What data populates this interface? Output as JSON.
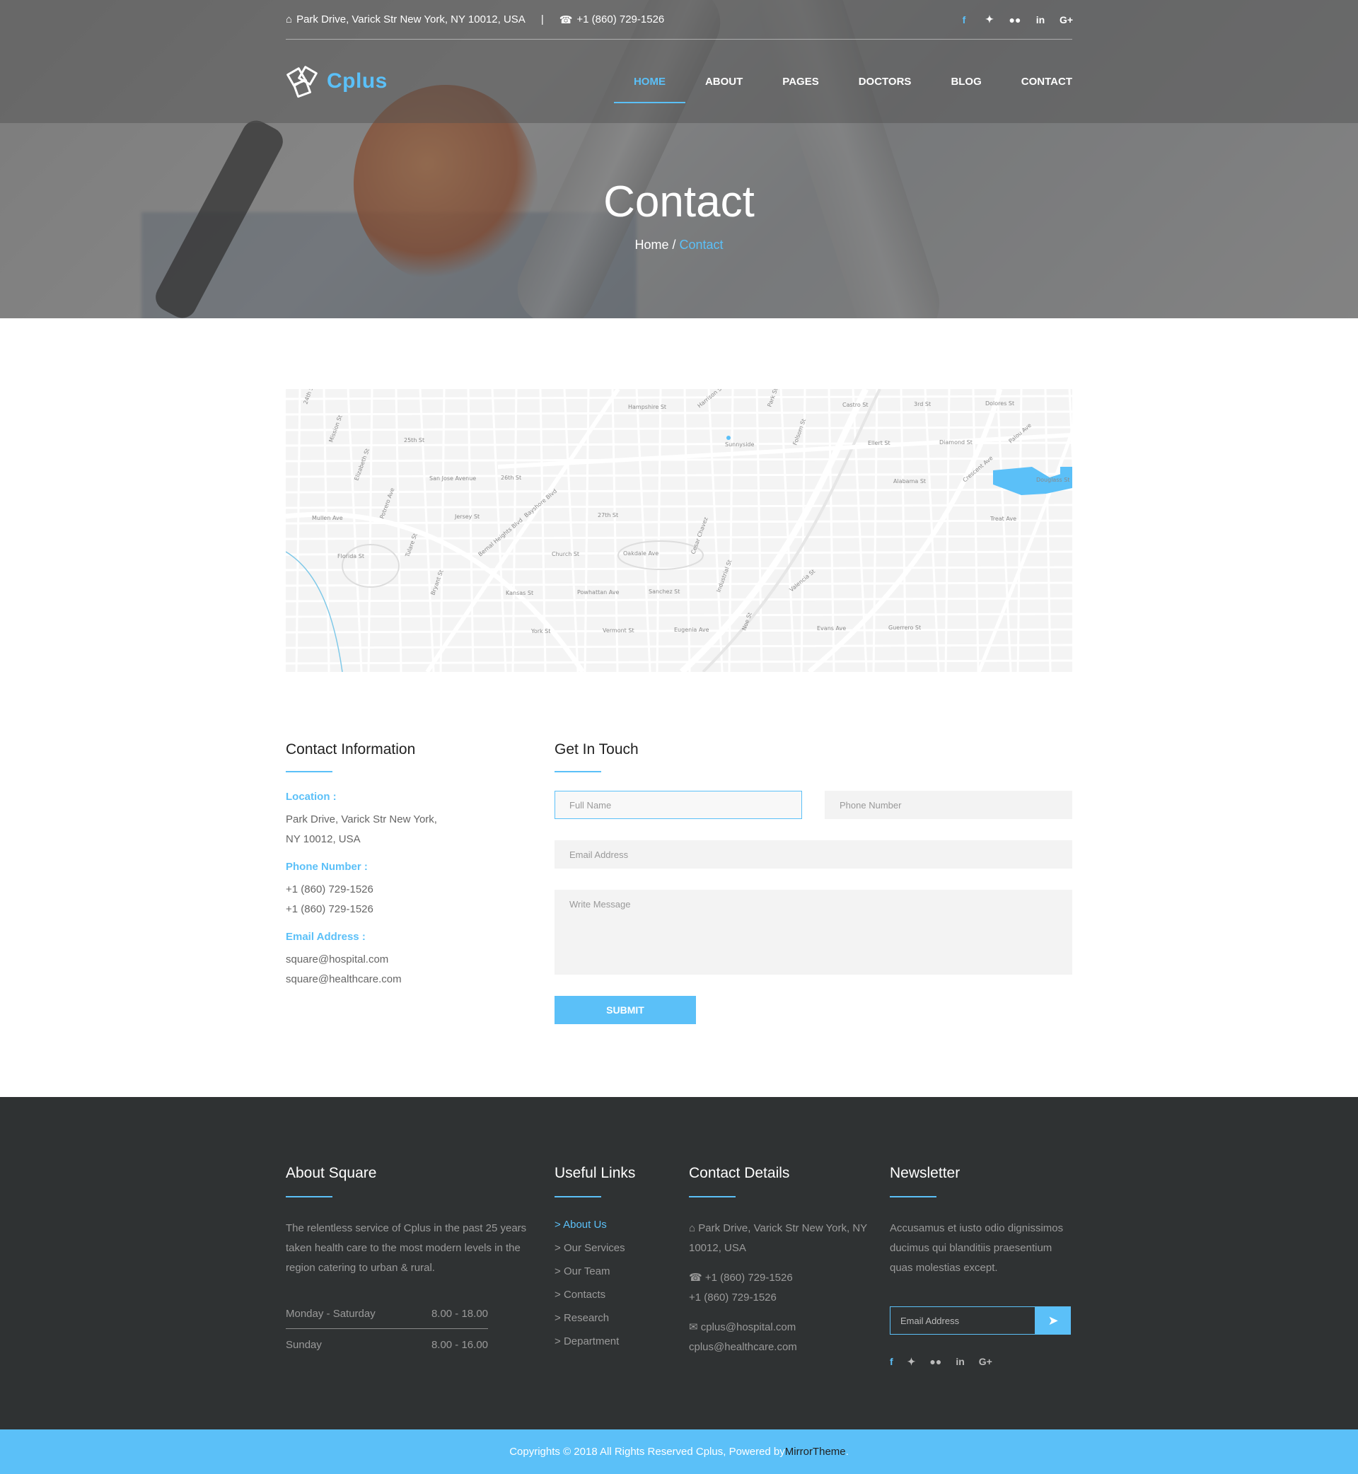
{
  "topbar": {
    "address": "Park Drive, Varick Str New York, NY 10012, USA",
    "separator": "|",
    "phone": "+1 (860) 729-1526",
    "social": [
      "f",
      "t",
      "fl",
      "in",
      "G+"
    ]
  },
  "brand": {
    "name": "Cplus"
  },
  "nav": {
    "items": [
      {
        "label": "HOME"
      },
      {
        "label": "ABOUT"
      },
      {
        "label": "PAGES"
      },
      {
        "label": "DOCTORS"
      },
      {
        "label": "BLOG"
      },
      {
        "label": "CONTACT"
      }
    ],
    "active_index": 0
  },
  "hero": {
    "title": "Contact",
    "breadcrumb_home": "Home",
    "breadcrumb_sep": " / ",
    "breadcrumb_current": "Contact"
  },
  "map": {
    "streets": [
      "24th St",
      "25th St",
      "26th St",
      "27th St",
      "Cesar Chavez",
      "Valencia St",
      "Guerrero St",
      "Dolores St",
      "Mission St",
      "San Jose Avenue",
      "Bayshore Blvd",
      "Oakdale Ave",
      "Industrial St",
      "Evans Ave",
      "3rd St",
      "Palou Ave",
      "Elizabeth St",
      "Jersey St",
      "Church St",
      "Sanchez St",
      "Noe St",
      "Castro St",
      "Diamond St",
      "Douglass St",
      "Potrero Ave",
      "Bernal Heights Blvd",
      "Powhattan Ave",
      "Eugenia Ave",
      "Park St",
      "Ellert St",
      "Crescent Ave",
      "Mullen Ave",
      "Tulare St",
      "Kansas St",
      "Vermont St",
      "Harrison St",
      "Folsom St",
      "Alabama St",
      "Treat Ave",
      "Florida St",
      "Bryant St",
      "York St",
      "Hampshire St",
      "Sunnyside"
    ]
  },
  "contact_info": {
    "heading": "Contact Information",
    "location_label": "Location :",
    "location_line1": "Park Drive, Varick Str New York,",
    "location_line2": "NY 10012, USA",
    "phone_label": "Phone Number :",
    "phone1": "+1 (860) 729-1526",
    "phone2": "+1 (860) 729-1526",
    "email_label": "Email Address :",
    "email1": "square@hospital.com",
    "email2": "square@healthcare.com"
  },
  "form": {
    "heading": "Get In Touch",
    "full_name_placeholder": "Full Name",
    "phone_placeholder": "Phone Number",
    "email_placeholder": "Email Address",
    "message_placeholder": "Write Message",
    "submit_label": "SUBMIT"
  },
  "footer": {
    "about_heading": "About Square",
    "about_text": "The relentless service of Cplus in the past 25 years taken health care to the most modern levels in the region catering to urban & rural.",
    "hours": [
      {
        "day": "Monday - Saturday",
        "time": "8.00 - 18.00"
      },
      {
        "day": "Sunday",
        "time": "8.00 - 16.00"
      }
    ],
    "links_heading": "Useful Links",
    "links": [
      "About Us",
      "Our Services",
      "Our Team",
      "Contacts",
      "Research",
      "Department"
    ],
    "links_prefix": "> ",
    "contact_heading": "Contact Details",
    "contact_address": "Park Drive, Varick Str New York, NY 10012, USA",
    "contact_phone1": "+1 (860) 729-1526",
    "contact_phone2": "+1 (860) 729-1526",
    "contact_email1": "cplus@hospital.com",
    "contact_email2": "cplus@healthcare.com",
    "newsletter_heading": "Newsletter",
    "newsletter_text": "Accusamus et iusto odio dignissimos ducimus qui blanditiis praesentium quas molestias except.",
    "newsletter_placeholder": "Email Address",
    "social": [
      "f",
      "t",
      "fl",
      "in",
      "G+"
    ]
  },
  "copyright": {
    "text": "Copyrights © 2018 All Rights Reserved Cplus, Powered by ",
    "brand": "MirrorTheme",
    "suffix": "."
  },
  "colors": {
    "accent": "#5bc0f8",
    "footer_bg": "#2f3233",
    "copyright_bg": "#5bc0f8"
  }
}
